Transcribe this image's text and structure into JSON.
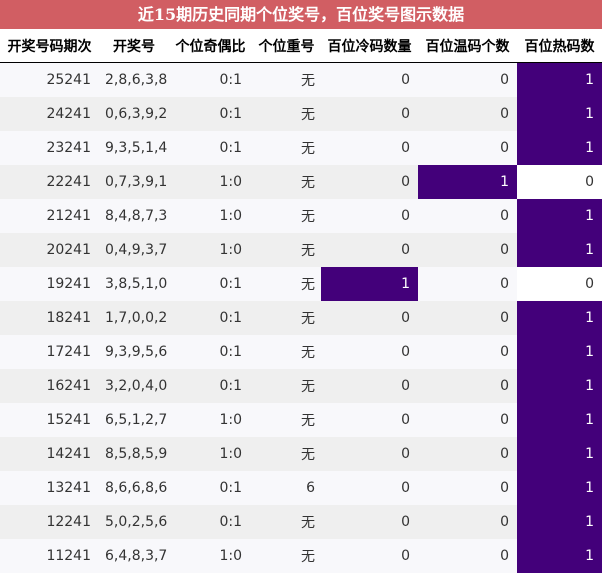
{
  "title": "近15期历史同期个位奖号，百位奖号图示数据",
  "headers": [
    "开奖号码期次",
    "开奖号",
    "个位奇偶比",
    "个位重号",
    "百位冷码数量",
    "百位温码个数",
    "百位热码数"
  ],
  "rows": [
    {
      "issue": "25241",
      "nums": "2,8,6,3,8",
      "ratio": "0:1",
      "repeat": "无",
      "cold": "0",
      "warm": "0",
      "hot": "1"
    },
    {
      "issue": "24241",
      "nums": "0,6,3,9,2",
      "ratio": "0:1",
      "repeat": "无",
      "cold": "0",
      "warm": "0",
      "hot": "1"
    },
    {
      "issue": "23241",
      "nums": "9,3,5,1,4",
      "ratio": "0:1",
      "repeat": "无",
      "cold": "0",
      "warm": "0",
      "hot": "1"
    },
    {
      "issue": "22241",
      "nums": "0,7,3,9,1",
      "ratio": "1:0",
      "repeat": "无",
      "cold": "0",
      "warm": "1",
      "hot": "0"
    },
    {
      "issue": "21241",
      "nums": "8,4,8,7,3",
      "ratio": "1:0",
      "repeat": "无",
      "cold": "0",
      "warm": "0",
      "hot": "1"
    },
    {
      "issue": "20241",
      "nums": "0,4,9,3,7",
      "ratio": "1:0",
      "repeat": "无",
      "cold": "0",
      "warm": "0",
      "hot": "1"
    },
    {
      "issue": "19241",
      "nums": "3,8,5,1,0",
      "ratio": "0:1",
      "repeat": "无",
      "cold": "1",
      "warm": "0",
      "hot": "0"
    },
    {
      "issue": "18241",
      "nums": "1,7,0,0,2",
      "ratio": "0:1",
      "repeat": "无",
      "cold": "0",
      "warm": "0",
      "hot": "1"
    },
    {
      "issue": "17241",
      "nums": "9,3,9,5,6",
      "ratio": "0:1",
      "repeat": "无",
      "cold": "0",
      "warm": "0",
      "hot": "1"
    },
    {
      "issue": "16241",
      "nums": "3,2,0,4,0",
      "ratio": "0:1",
      "repeat": "无",
      "cold": "0",
      "warm": "0",
      "hot": "1"
    },
    {
      "issue": "15241",
      "nums": "6,5,1,2,7",
      "ratio": "1:0",
      "repeat": "无",
      "cold": "0",
      "warm": "0",
      "hot": "1"
    },
    {
      "issue": "14241",
      "nums": "8,5,8,5,9",
      "ratio": "1:0",
      "repeat": "无",
      "cold": "0",
      "warm": "0",
      "hot": "1"
    },
    {
      "issue": "13241",
      "nums": "8,6,6,8,6",
      "ratio": "0:1",
      "repeat": "6",
      "cold": "0",
      "warm": "0",
      "hot": "1"
    },
    {
      "issue": "12241",
      "nums": "5,0,2,5,6",
      "ratio": "0:1",
      "repeat": "无",
      "cold": "0",
      "warm": "0",
      "hot": "1"
    },
    {
      "issue": "11241",
      "nums": "6,4,8,3,7",
      "ratio": "1:0",
      "repeat": "无",
      "cold": "0",
      "warm": "0",
      "hot": "1"
    }
  ],
  "colors": {
    "title_bg": "#d15e63",
    "highlight": "#43007a"
  }
}
